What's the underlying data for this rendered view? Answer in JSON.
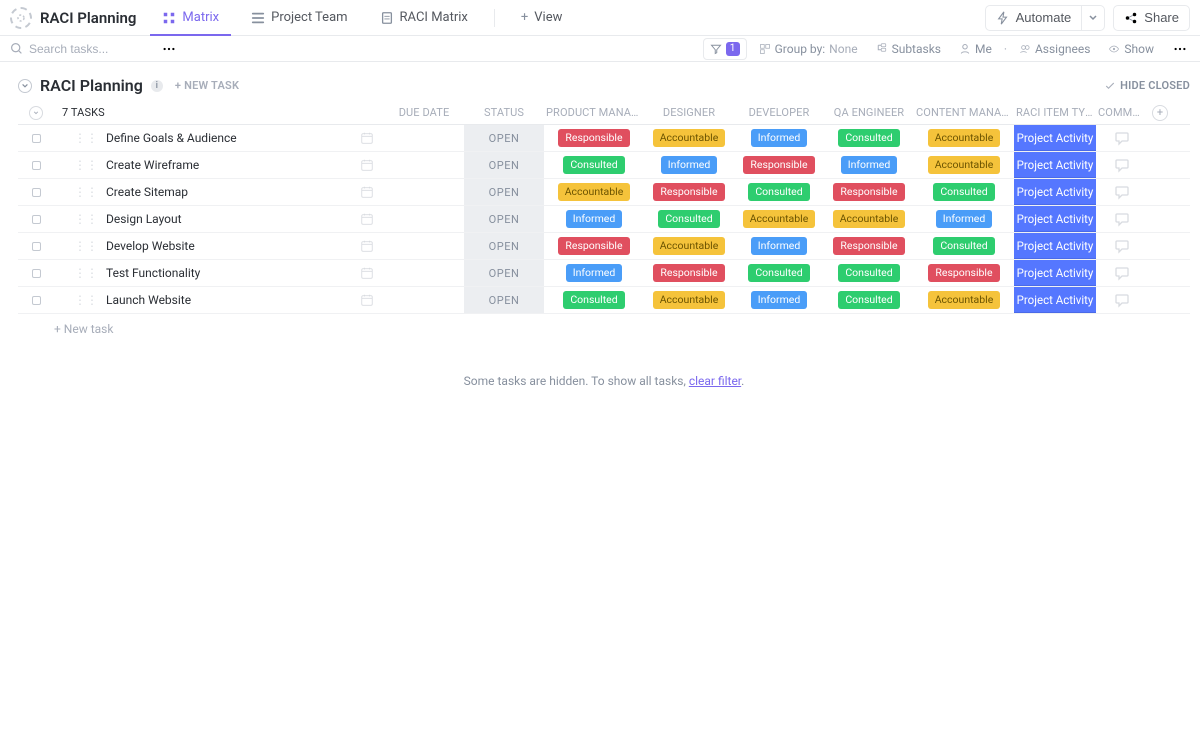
{
  "header": {
    "title": "RACI Planning",
    "tabs": [
      {
        "label": "Matrix",
        "icon": "matrix-icon",
        "active": true
      },
      {
        "label": "Project Team",
        "icon": "list-icon",
        "active": false
      },
      {
        "label": "RACI Matrix",
        "icon": "doc-icon",
        "active": false
      }
    ],
    "view_label": "View",
    "automate_label": "Automate",
    "share_label": "Share"
  },
  "toolbar": {
    "search_placeholder": "Search tasks...",
    "filter_count": "1",
    "group_by_label": "Group by:",
    "group_by_value": "None",
    "subtasks_label": "Subtasks",
    "me_label": "Me",
    "assignees_label": "Assignees",
    "show_label": "Show"
  },
  "list": {
    "name": "RACI Planning",
    "new_task_label": "+ New task",
    "hide_closed_label": "Hide Closed",
    "task_count_label": "7 tasks",
    "bottom_new_task": "+ New task"
  },
  "columns": {
    "due_date": "Due Date",
    "status": "Status",
    "pm": "Product Manager",
    "designer": "Designer",
    "developer": "Developer",
    "qa": "QA Engineer",
    "cm": "Content Manager",
    "item_type": "RACI Item Type",
    "comments": "Comments"
  },
  "status_open": "OPEN",
  "raci_item_type": "Project Activity",
  "tasks": [
    {
      "name": "Define Goals & Audience",
      "pm": {
        "text": "Responsible",
        "c": "t-red"
      },
      "designer": {
        "text": "Accountable",
        "c": "t-yellow"
      },
      "developer": {
        "text": "Informed",
        "c": "t-blue"
      },
      "qa": {
        "text": "Consulted",
        "c": "t-green"
      },
      "cm": {
        "text": "Accountable",
        "c": "t-yellow"
      }
    },
    {
      "name": "Create Wireframe",
      "pm": {
        "text": "Consulted",
        "c": "t-green"
      },
      "designer": {
        "text": "Informed",
        "c": "t-blue"
      },
      "developer": {
        "text": "Responsible",
        "c": "t-red"
      },
      "qa": {
        "text": "Informed",
        "c": "t-blue"
      },
      "cm": {
        "text": "Accountable",
        "c": "t-yellow"
      }
    },
    {
      "name": "Create Sitemap",
      "pm": {
        "text": "Accountable",
        "c": "t-yellow"
      },
      "designer": {
        "text": "Responsible",
        "c": "t-red"
      },
      "developer": {
        "text": "Consulted",
        "c": "t-green"
      },
      "qa": {
        "text": "Responsible",
        "c": "t-red"
      },
      "cm": {
        "text": "Consulted",
        "c": "t-green"
      }
    },
    {
      "name": "Design Layout",
      "pm": {
        "text": "Informed",
        "c": "t-blue"
      },
      "designer": {
        "text": "Consulted",
        "c": "t-green"
      },
      "developer": {
        "text": "Accountable",
        "c": "t-yellow"
      },
      "qa": {
        "text": "Accountable",
        "c": "t-yellow"
      },
      "cm": {
        "text": "Informed",
        "c": "t-blue"
      }
    },
    {
      "name": "Develop Website",
      "pm": {
        "text": "Responsible",
        "c": "t-red"
      },
      "designer": {
        "text": "Accountable",
        "c": "t-yellow"
      },
      "developer": {
        "text": "Informed",
        "c": "t-blue"
      },
      "qa": {
        "text": "Responsible",
        "c": "t-red"
      },
      "cm": {
        "text": "Consulted",
        "c": "t-green"
      }
    },
    {
      "name": "Test Functionality",
      "pm": {
        "text": "Informed",
        "c": "t-blue"
      },
      "designer": {
        "text": "Responsible",
        "c": "t-red"
      },
      "developer": {
        "text": "Consulted",
        "c": "t-green"
      },
      "qa": {
        "text": "Consulted",
        "c": "t-green"
      },
      "cm": {
        "text": "Responsible",
        "c": "t-red"
      }
    },
    {
      "name": "Launch Website",
      "pm": {
        "text": "Consulted",
        "c": "t-green"
      },
      "designer": {
        "text": "Accountable",
        "c": "t-yellow"
      },
      "developer": {
        "text": "Informed",
        "c": "t-blue"
      },
      "qa": {
        "text": "Consulted",
        "c": "t-green"
      },
      "cm": {
        "text": "Accountable",
        "c": "t-yellow"
      }
    }
  ],
  "footer": {
    "msg_a": "Some tasks are hidden. To show all tasks, ",
    "link": "clear filter",
    "msg_b": "."
  }
}
